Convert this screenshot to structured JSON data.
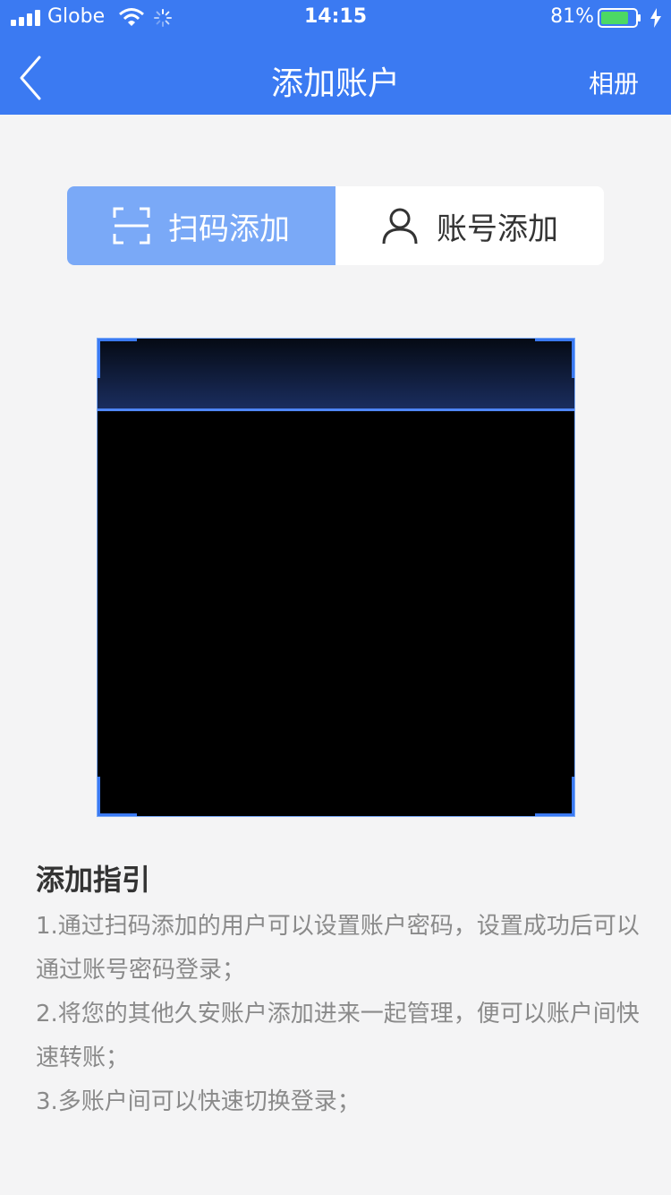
{
  "status_bar": {
    "carrier": "Globe",
    "time": "14:15",
    "battery_percent": "81%",
    "battery_level": 0.81,
    "signal_icon": "signal-bars-icon",
    "wifi_icon": "wifi-icon",
    "activity_icon": "activity-spinner-icon",
    "charging_icon": "charging-bolt-icon"
  },
  "nav": {
    "back_icon": "chevron-left-icon",
    "title": "添加账户",
    "album_label": "相册"
  },
  "tabs": [
    {
      "label": "扫码添加",
      "icon": "scan-icon",
      "active": true
    },
    {
      "label": "账号添加",
      "icon": "person-icon",
      "active": false
    }
  ],
  "guide": {
    "title": "添加指引",
    "items": [
      "1.通过扫码添加的用户可以设置账户密码，设置成功后可以通过账号密码登录；",
      "2.将您的其他久安账户添加进来一起管理，便可以账户间快速转账；",
      "3.多账户间可以快速切换登录；"
    ]
  },
  "colors": {
    "primary": "#3b7af2",
    "tab_active": "#7aa9f7",
    "background": "#f4f4f5",
    "guide_text": "#8a8a8a",
    "title_text": "#333333"
  }
}
